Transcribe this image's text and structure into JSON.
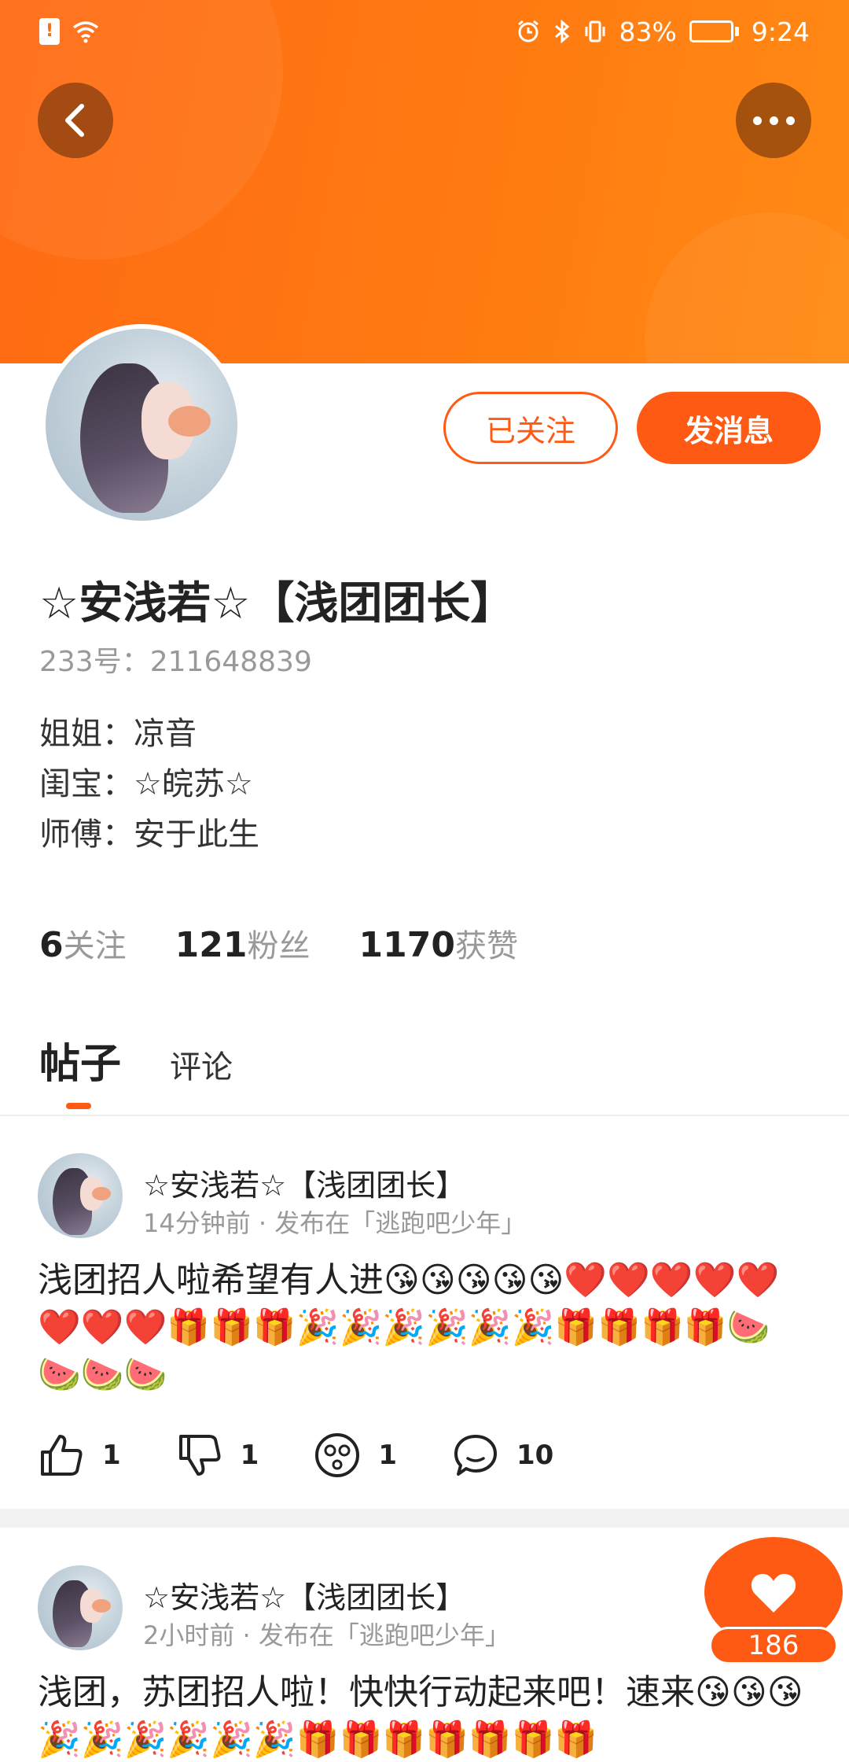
{
  "status_bar": {
    "battery": "83%",
    "time": "9:24",
    "battery_level": 0.83
  },
  "profile": {
    "display_name": "☆安浅若☆【浅团团长】",
    "user_id": "233号：211648839",
    "follow_button": "已关注",
    "message_button": "发消息",
    "relations": [
      "姐姐：凉音",
      "闺宝：☆皖苏☆",
      "师傅：安于此生"
    ],
    "stats": [
      {
        "value": "6",
        "label": "关注"
      },
      {
        "value": "121",
        "label": "粉丝"
      },
      {
        "value": "1170",
        "label": "获赞"
      }
    ]
  },
  "tabs": {
    "posts": "帖子",
    "comments": "评论"
  },
  "posts": [
    {
      "author": "☆安浅若☆【浅团团长】",
      "meta": "14分钟前 · 发布在「逃跑吧少年」",
      "text": "浅团招人啦希望有人进😘😘😘😘😘❤️❤️❤️❤️❤️❤️❤️❤️🎁🎁🎁🎉🎉🎉🎉🎉🎉🎁🎁🎁🎁🍉🍉🍉🍉",
      "likes": "1",
      "dislikes": "1",
      "reactions": "1",
      "comments": "10"
    },
    {
      "author": "☆安浅若☆【浅团团长】",
      "meta": "2小时前 · 发布在「逃跑吧少年」",
      "text": "浅团，苏团招人啦！快快行动起来吧！速来😘😘😘🎉🎉🎉🎉🎉🎉🎁🎁🎁🎁🎁🎁🎁"
    }
  ],
  "floating_like": {
    "count": "186"
  },
  "colors": {
    "accent": "#ff5a14",
    "banner": "#ff7a12"
  },
  "icons": {
    "back": "back-arrow-icon",
    "more": "more-dots-icon",
    "like": "thumbs-up-icon",
    "dislike": "thumbs-down-icon",
    "reaction": "dizzy-face-icon",
    "comment": "comment-bubble-icon",
    "heart": "heart-icon"
  }
}
